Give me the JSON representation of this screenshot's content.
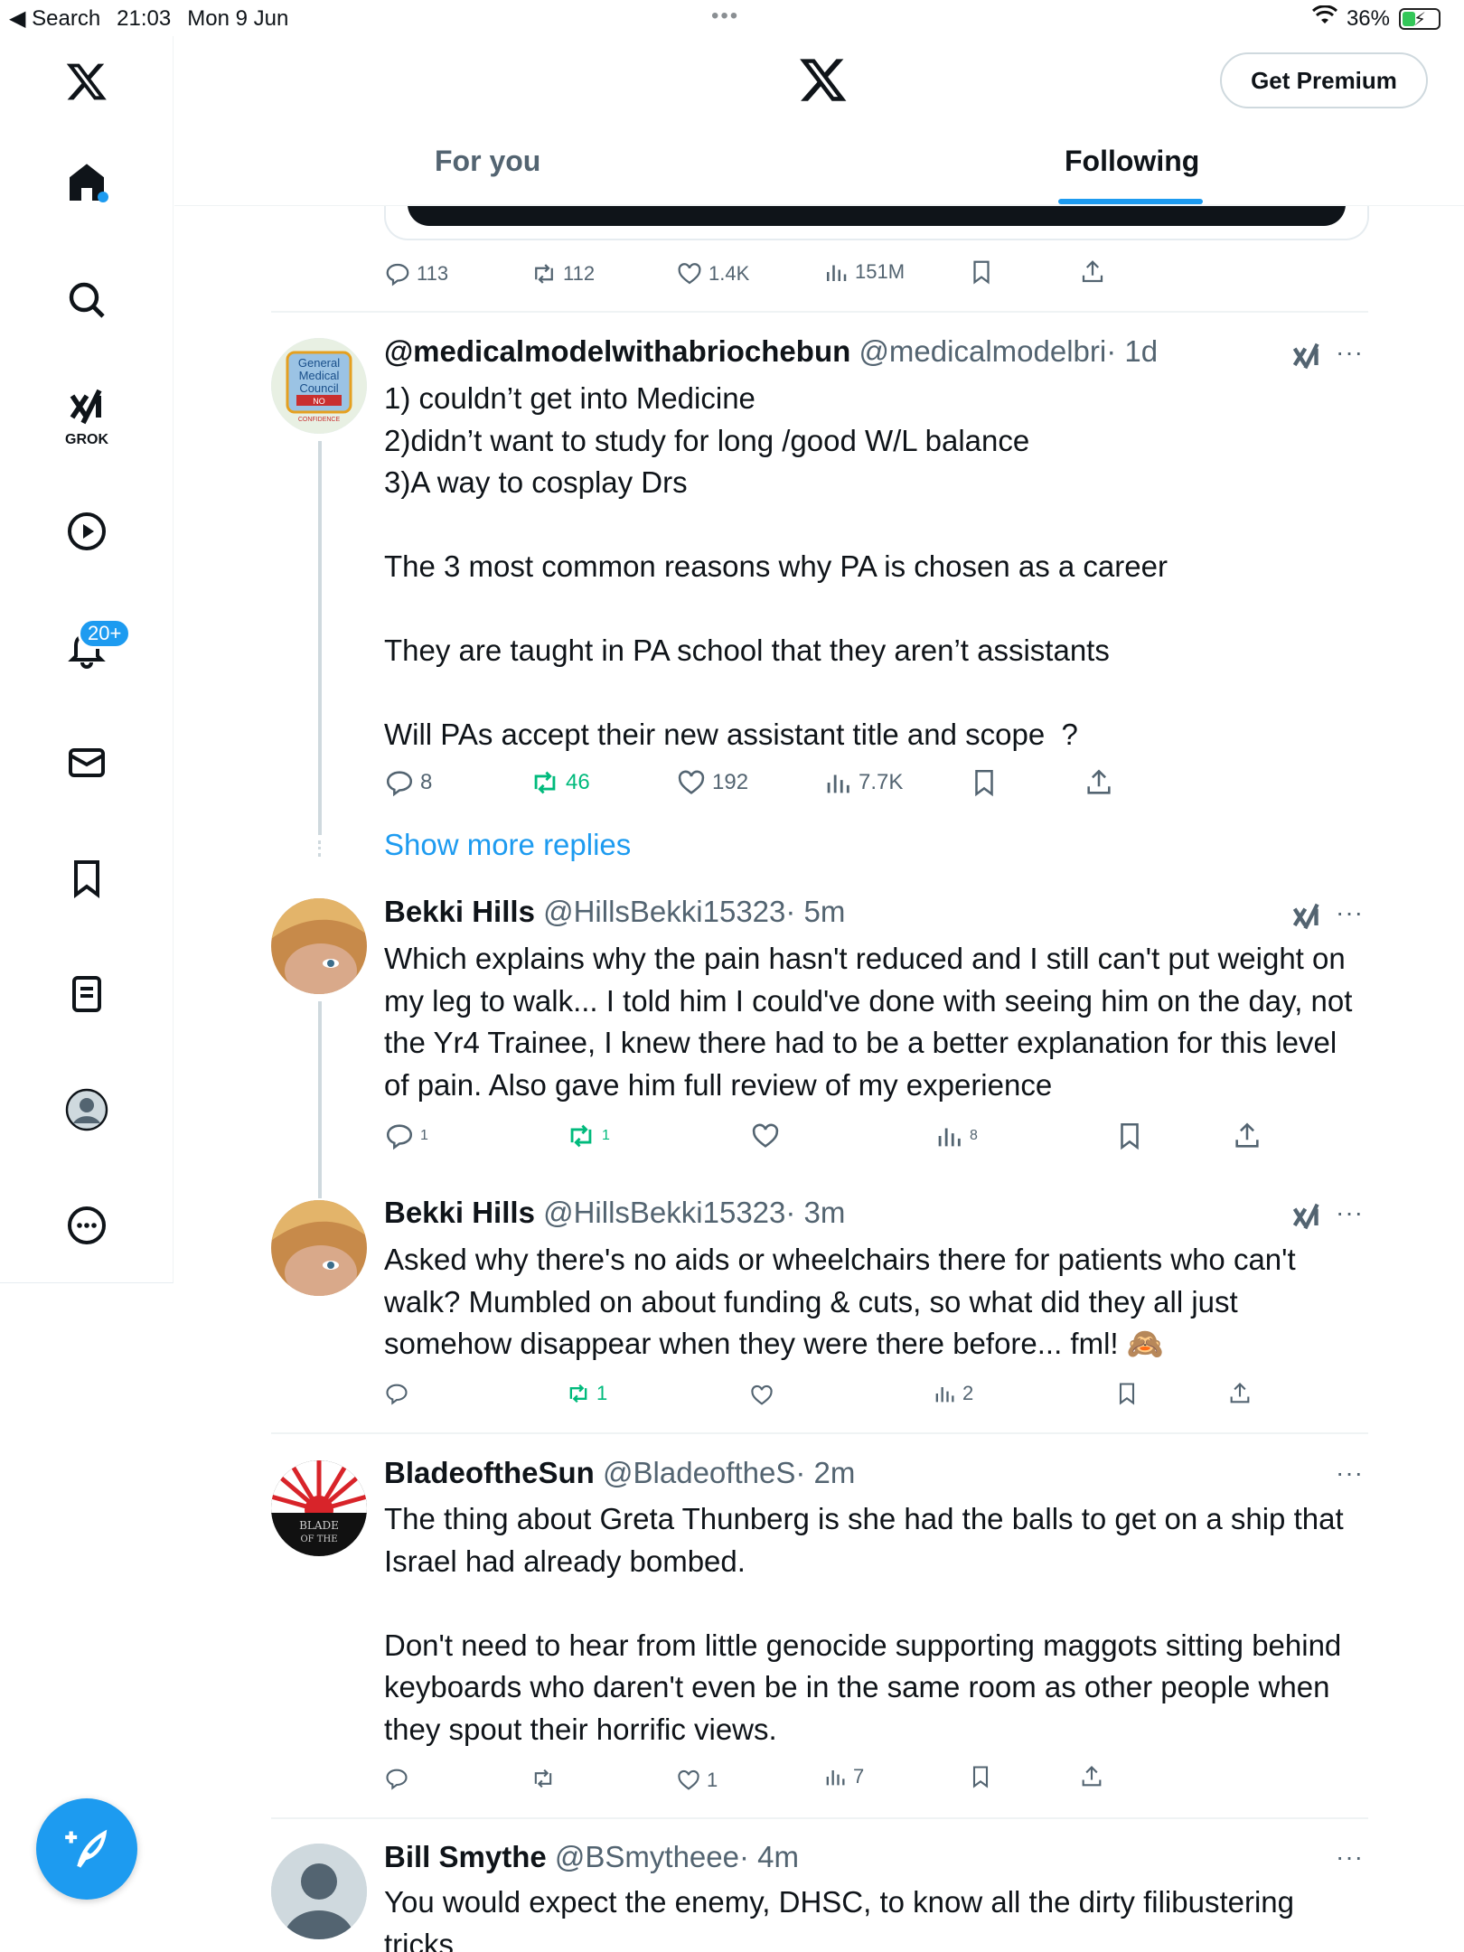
{
  "status_bar": {
    "back_label": "◀ Search",
    "time": "21:03",
    "date": "Mon 9 Jun",
    "battery": "36%",
    "battery_level": 0.36
  },
  "sidebar": {
    "grok_label": "GROK",
    "notifications_badge": "20+"
  },
  "header": {
    "premium_label": "Get Premium",
    "tabs": [
      {
        "label": "For you",
        "active": false
      },
      {
        "label": "Following",
        "active": true
      }
    ]
  },
  "previous_post": {
    "replies": "113",
    "reposts": "112",
    "likes": "1.4K",
    "views": "151M"
  },
  "show_more_replies": "Show more replies",
  "posts": [
    {
      "name": "@medicalmodelwithabriochebun",
      "handle": "@medicalmodelbri",
      "time": "· 1d",
      "text": "1) couldn’t get into Medicine\n2)didn’t want to study for long /good W/L balance\n3)A way to cosplay Drs\n\nThe 3 most common reasons why PA is chosen as a career\n\nThey are taught in PA school that they aren’t assistants\n\nWill PAs accept their new assistant title and scope  ?",
      "replies": "8",
      "reposts": "46",
      "likes": "192",
      "views": "7.7K",
      "avatar_text": [
        "General",
        "Medical",
        "Council",
        "NO",
        "CONFIDENCE"
      ]
    },
    {
      "name": "Bekki Hills",
      "handle": "@HillsBekki15323",
      "time": "· 5m",
      "text": "Which explains why the pain hasn't reduced and I still can't put weight on my leg to walk... I told him I could've done with seeing him on the day, not the Yr4 Trainee, I knew there had to be a better explanation for this level of pain. Also gave him full review of my experience",
      "replies": "1",
      "reposts": "1",
      "likes": "",
      "views": "8"
    },
    {
      "name": "Bekki Hills",
      "handle": "@HillsBekki15323",
      "time": "· 3m",
      "text": "Asked why there's no aids or wheelchairs there for patients who can't walk? Mumbled on about funding & cuts, so what did they all just somehow disappear when they were there before... fml! 🙈",
      "replies": "",
      "reposts": "1",
      "likes": "",
      "views": "2"
    },
    {
      "name": "BladeoftheSun",
      "handle": "@BladeoftheS",
      "time": "· 2m",
      "text": "The thing about Greta Thunberg is she had the balls to get on a ship that Israel had already bombed.\n\nDon't need to hear from little genocide supporting maggots sitting behind keyboards who daren't even be in the same room as other people when they spout their horrific views.",
      "replies": "",
      "reposts": "",
      "likes": "1",
      "views": "7",
      "avatar_text": [
        "BLADE",
        "OF THE"
      ]
    },
    {
      "name": "Bill Smythe",
      "handle": "@BSmytheee",
      "time": "· 4m",
      "text": "You would expect the enemy, DHSC, to know all the dirty filibustering tricks"
    }
  ]
}
